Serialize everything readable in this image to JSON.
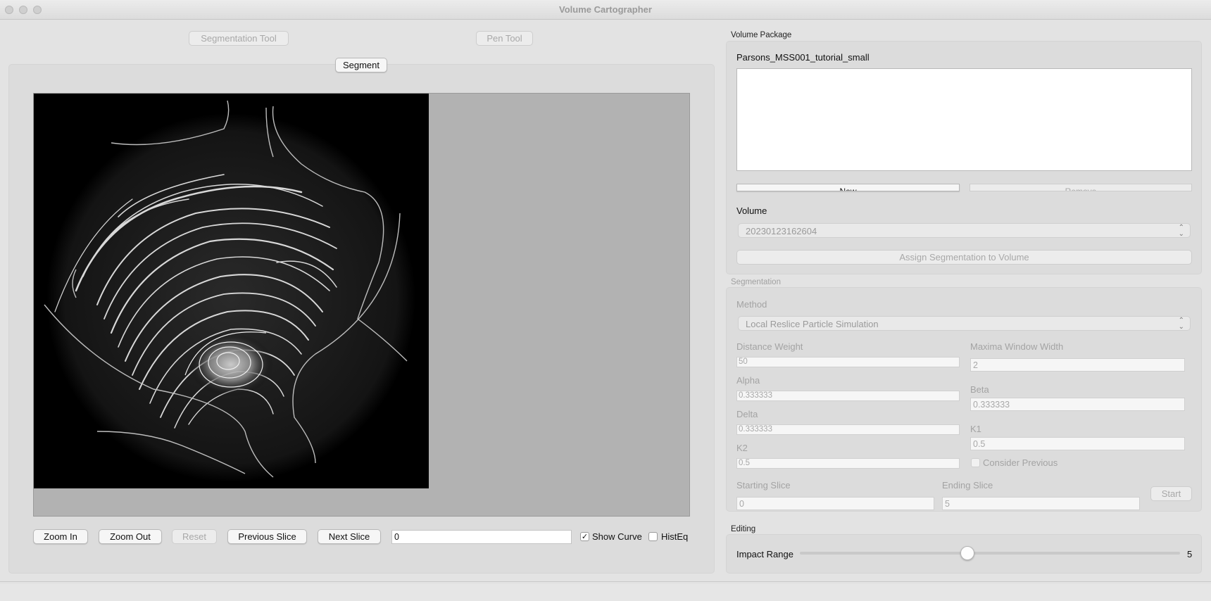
{
  "window": {
    "title": "Volume Cartographer"
  },
  "tools": {
    "segmentation_tool": "Segmentation Tool",
    "pen_tool": "Pen Tool",
    "segment_tab": "Segment"
  },
  "viewer": {
    "zoom_in": "Zoom In",
    "zoom_out": "Zoom Out",
    "reset": "Reset",
    "previous_slice": "Previous Slice",
    "next_slice": "Next Slice",
    "slice_value": "0",
    "show_curve": "Show Curve",
    "show_curve_checked": true,
    "histeq": "HistEq",
    "histeq_checked": false
  },
  "volume_package": {
    "title": "Volume Package",
    "name": "Parsons_MSS001_tutorial_small",
    "new_label": "New",
    "remove_label": "Remove",
    "volume_label": "Volume",
    "volume_selected": "20230123162604",
    "assign_label": "Assign Segmentation to Volume"
  },
  "segmentation": {
    "title": "Segmentation",
    "method_label": "Method",
    "method_selected": "Local Reslice Particle Simulation",
    "distance_weight_label": "Distance Weight",
    "distance_weight": "50",
    "maxima_window_label": "Maxima Window Width",
    "maxima_window": "2",
    "alpha_label": "Alpha",
    "alpha": "0.333333",
    "beta_label": "Beta",
    "beta": "0.333333",
    "delta_label": "Delta",
    "delta": "0.333333",
    "k1_label": "K1",
    "k1": "0.5",
    "k2_label": "K2",
    "k2": "0.5",
    "consider_previous": "Consider Previous",
    "starting_slice_label": "Starting Slice",
    "starting_slice": "0",
    "ending_slice_label": "Ending Slice",
    "ending_slice": "5",
    "start_label": "Start"
  },
  "editing": {
    "title": "Editing",
    "impact_range_label": "Impact Range",
    "impact_range_value": "5",
    "impact_range_fraction": 0.44
  }
}
